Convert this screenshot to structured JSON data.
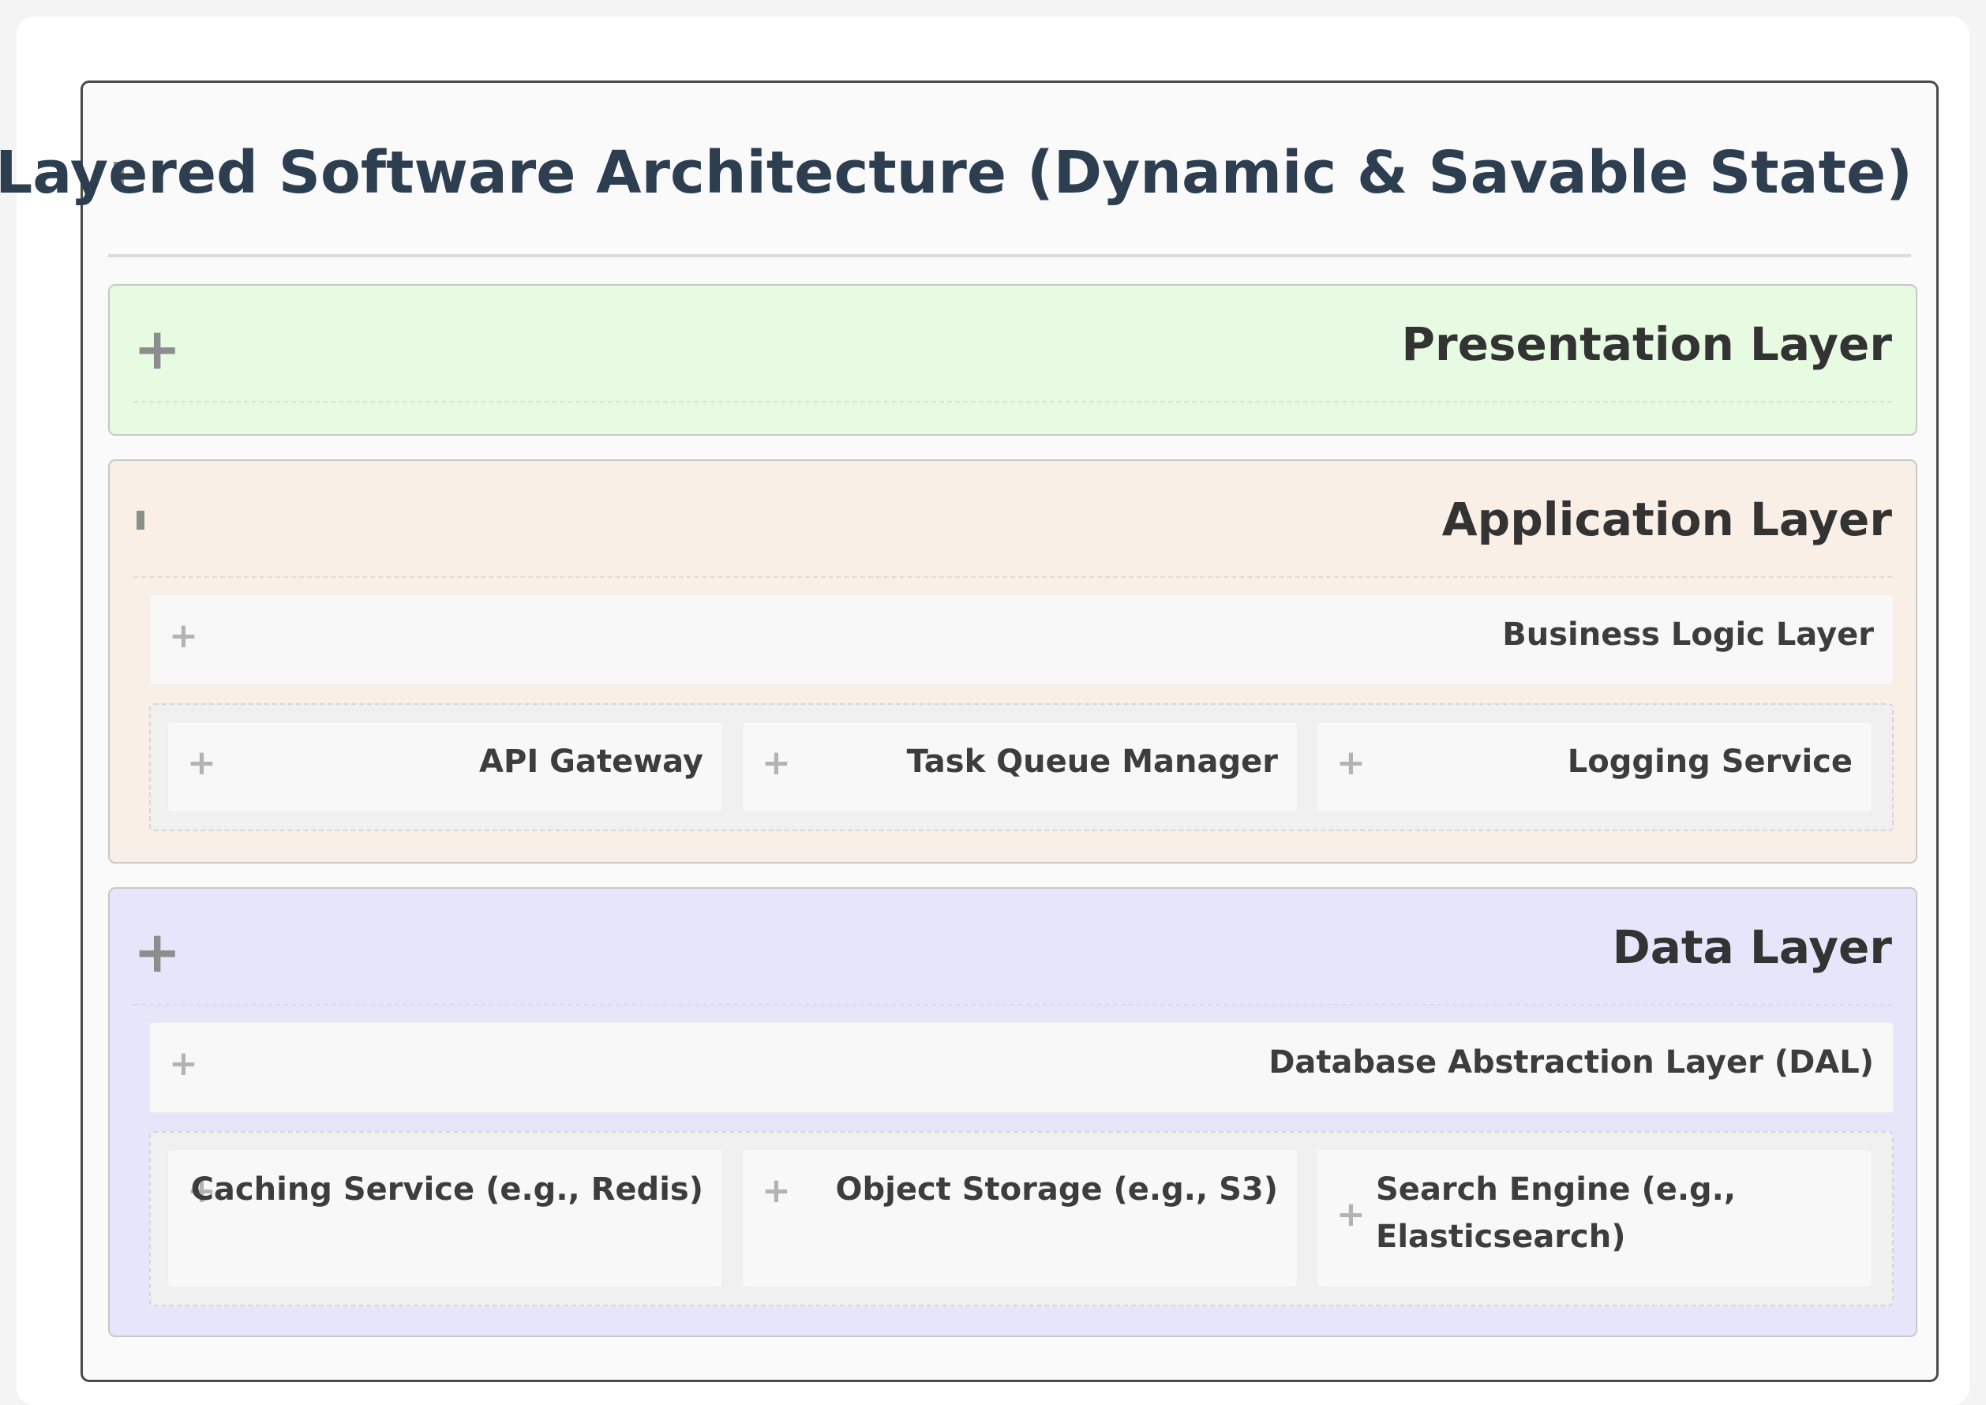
{
  "title": "Layered Software Architecture (Dynamic & Savable State)",
  "icons": {
    "expand": "+",
    "collapse": "minus-bar"
  },
  "colors": {
    "presentation_bg": "#e7fbe3",
    "application_bg": "#faefe6",
    "data_bg": "#e6e6fb",
    "title_color": "#2c3e50"
  },
  "layers": {
    "presentation": {
      "label": "Presentation Layer",
      "state": "collapsed"
    },
    "application": {
      "label": "Application Layer",
      "state": "expanded",
      "sublayer": {
        "label": "Business Logic Layer"
      },
      "components": [
        {
          "label": "API Gateway"
        },
        {
          "label": "Task Queue Manager"
        },
        {
          "label": "Logging Service"
        }
      ]
    },
    "data": {
      "label": "Data Layer",
      "state": "collapsed",
      "sublayer": {
        "label": "Database Abstraction Layer (DAL)"
      },
      "components": [
        {
          "label": "Caching Service (e.g., Redis)"
        },
        {
          "label": "Object Storage (e.g., S3)"
        },
        {
          "label": "Search Engine (e.g., Elasticsearch)"
        }
      ]
    }
  }
}
